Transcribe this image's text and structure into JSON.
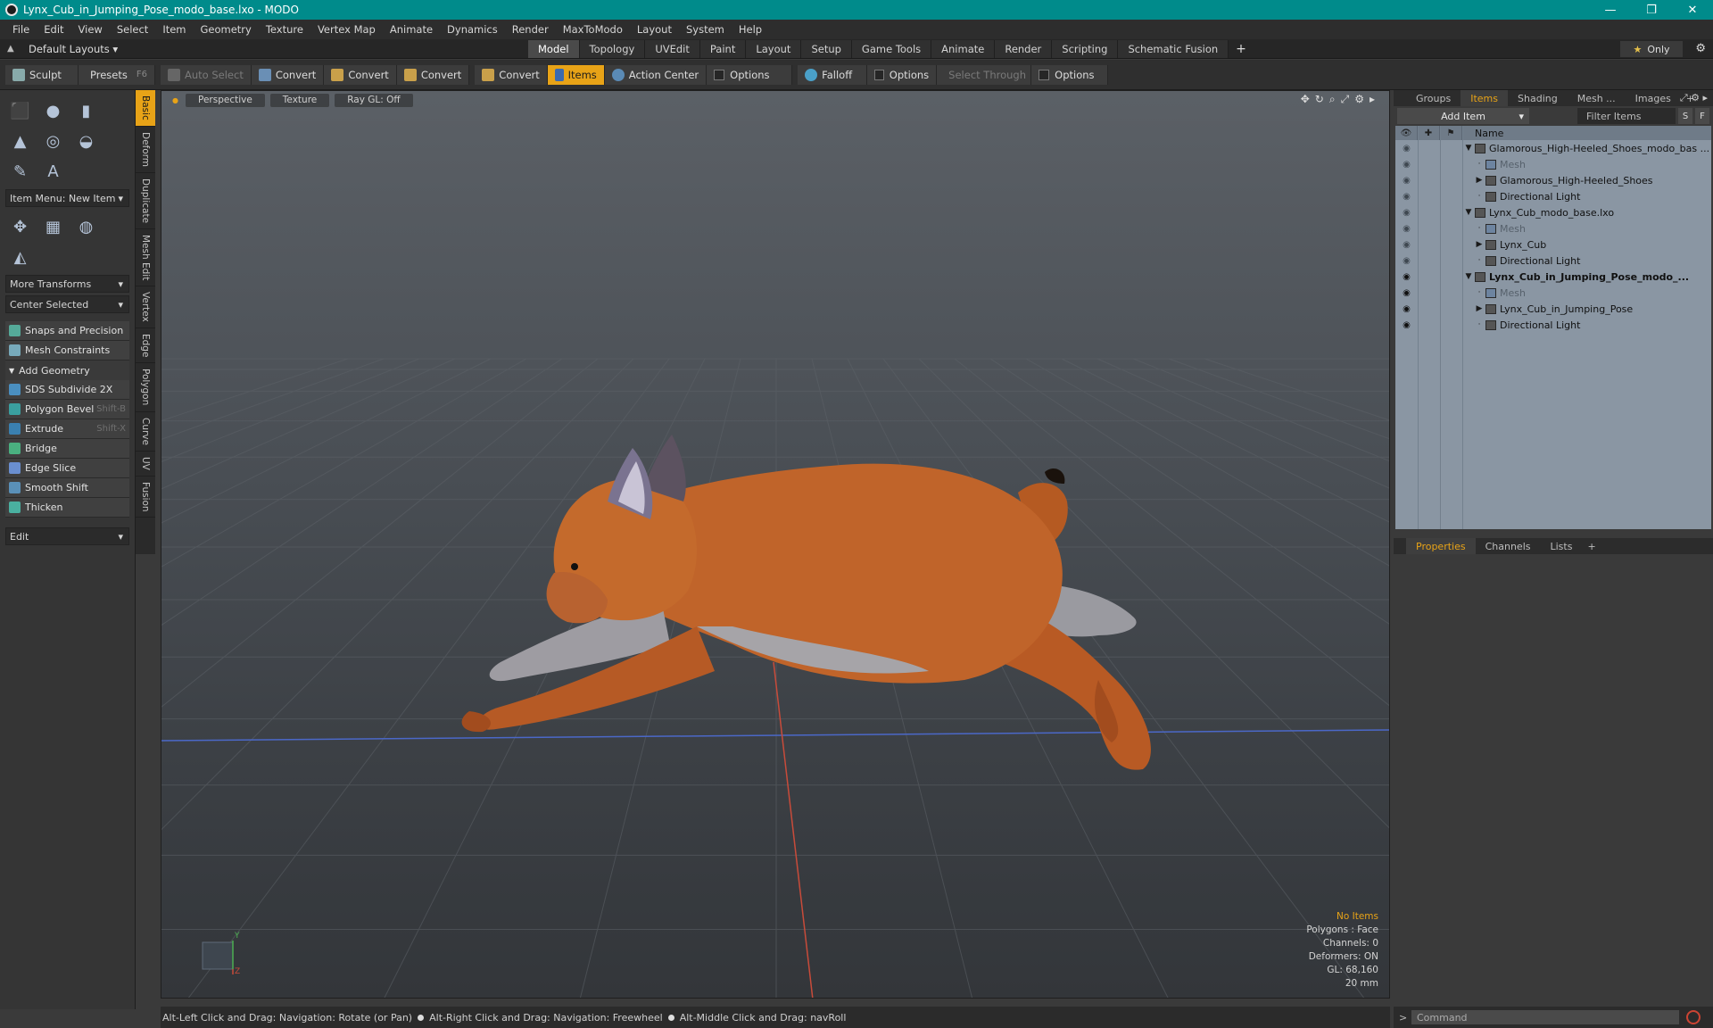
{
  "window": {
    "title": "Lynx_Cub_in_Jumping_Pose_modo_base.lxo - MODO",
    "minimize": "—",
    "maximize": "❐",
    "close": "✕"
  },
  "menu": [
    "File",
    "Edit",
    "View",
    "Select",
    "Item",
    "Geometry",
    "Texture",
    "Vertex Map",
    "Animate",
    "Dynamics",
    "Render",
    "MaxToModo",
    "Layout",
    "System",
    "Help"
  ],
  "layout_bar": {
    "layouts_label": "Default Layouts ▾",
    "tabs": [
      "Model",
      "Topology",
      "UVEdit",
      "Paint",
      "Layout",
      "Setup",
      "Game Tools",
      "Animate",
      "Render",
      "Scripting",
      "Schematic Fusion"
    ],
    "active_tab": "Model",
    "add_tab": "+",
    "only_label": "Only",
    "only_star": "★"
  },
  "toolbar": {
    "sculpt": "Sculpt",
    "presets": "Presets",
    "presets_shortcut": "F6",
    "auto_select": "Auto Select",
    "convert1": "Convert",
    "convert2": "Convert",
    "convert3": "Convert",
    "convert4": "Convert",
    "items": "Items",
    "action_center": "Action Center",
    "options1": "Options",
    "falloff": "Falloff",
    "options2": "Options",
    "select_through": "Select Through",
    "options3": "Options"
  },
  "left_panel": {
    "item_menu": "Item Menu: New Item",
    "more_transforms": "More Transforms",
    "center_selected": "Center Selected",
    "snaps": "Snaps and Precision",
    "mesh_constraints": "Mesh Constraints",
    "add_geometry": "Add Geometry",
    "tools": [
      {
        "label": "SDS Subdivide 2X",
        "shortcut": ""
      },
      {
        "label": "Polygon Bevel",
        "shortcut": "Shift-B"
      },
      {
        "label": "Extrude",
        "shortcut": "Shift-X"
      },
      {
        "label": "Bridge",
        "shortcut": ""
      },
      {
        "label": "Edge Slice",
        "shortcut": ""
      },
      {
        "label": "Smooth Shift",
        "shortcut": ""
      },
      {
        "label": "Thicken",
        "shortcut": ""
      }
    ],
    "edit_dropdown": "Edit"
  },
  "vertical_tabs": [
    "Basic",
    "Deform",
    "Duplicate",
    "Mesh Edit",
    "Vertex",
    "Edge",
    "Polygon",
    "Curve",
    "UV",
    "Fusion"
  ],
  "viewport": {
    "view_mode": "Perspective",
    "shading": "Texture",
    "raygl": "Ray GL: Off",
    "info": {
      "selection": "No Items",
      "polygons": "Polygons : Face",
      "channels": "Channels: 0",
      "deformers": "Deformers: ON",
      "gl": "GL: 68,160",
      "scale": "20 mm"
    },
    "axis_y": "Y",
    "axis_z": "Z"
  },
  "status_bar": {
    "hint1": "Alt-Left Click and Drag: Navigation: Rotate (or Pan)",
    "hint2": "Alt-Right Click and Drag: Navigation: Freewheel",
    "hint3": "Alt-Middle Click and Drag: navRoll"
  },
  "items_panel": {
    "tabs": [
      "Groups",
      "Items",
      "Shading",
      "Mesh ...",
      "Images"
    ],
    "active_tab": "Items",
    "add_item": "Add Item",
    "filter_placeholder": "Filter Items",
    "s_button": "S",
    "f_button": "F",
    "column_name": "Name",
    "tree": [
      {
        "label": "Glamorous_High-Heeled_Shoes_modo_bas ...",
        "depth": 0,
        "arrow": "▼",
        "bold": false,
        "dim": false,
        "eye_on": false
      },
      {
        "label": "Mesh",
        "depth": 1,
        "arrow": "",
        "bold": false,
        "dim": true,
        "eye_on": false
      },
      {
        "label": "Glamorous_High-Heeled_Shoes",
        "depth": 1,
        "arrow": "▶",
        "bold": false,
        "dim": false,
        "eye_on": false
      },
      {
        "label": "Directional Light",
        "depth": 1,
        "arrow": "",
        "bold": false,
        "dim": false,
        "eye_on": false
      },
      {
        "label": "Lynx_Cub_modo_base.lxo",
        "depth": 0,
        "arrow": "▼",
        "bold": false,
        "dim": false,
        "eye_on": false
      },
      {
        "label": "Mesh",
        "depth": 1,
        "arrow": "",
        "bold": false,
        "dim": true,
        "eye_on": false
      },
      {
        "label": "Lynx_Cub",
        "depth": 1,
        "arrow": "▶",
        "bold": false,
        "dim": false,
        "eye_on": false
      },
      {
        "label": "Directional Light",
        "depth": 1,
        "arrow": "",
        "bold": false,
        "dim": false,
        "eye_on": false
      },
      {
        "label": "Lynx_Cub_in_Jumping_Pose_modo_...",
        "depth": 0,
        "arrow": "▼",
        "bold": true,
        "dim": false,
        "eye_on": true
      },
      {
        "label": "Mesh",
        "depth": 1,
        "arrow": "",
        "bold": false,
        "dim": true,
        "eye_on": true
      },
      {
        "label": "Lynx_Cub_in_Jumping_Pose",
        "depth": 1,
        "arrow": "▶",
        "bold": false,
        "dim": false,
        "eye_on": true
      },
      {
        "label": "Directional Light",
        "depth": 1,
        "arrow": "",
        "bold": false,
        "dim": false,
        "eye_on": true
      }
    ]
  },
  "properties_panel": {
    "tabs": [
      "Properties",
      "Channels",
      "Lists"
    ],
    "active_tab": "Properties",
    "add": "+"
  },
  "command": {
    "placeholder": "Command"
  },
  "colors": {
    "accent": "#e8a317",
    "titlebar": "#008b8b",
    "tree_bg": "#8a96a3"
  }
}
